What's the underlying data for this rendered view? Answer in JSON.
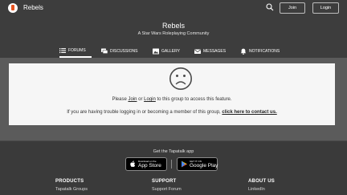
{
  "topbar": {
    "app_title": "Rebels",
    "join_label": "Join",
    "login_label": "Login"
  },
  "header": {
    "group_name": "Rebels",
    "group_description": "A Star Wars Roleplaying Community",
    "tabs": [
      {
        "label": "FORUMS",
        "icon": "list-icon",
        "active": true
      },
      {
        "label": "DISCUSSIONS",
        "icon": "chat-icon",
        "active": false
      },
      {
        "label": "GALLERY",
        "icon": "image-icon",
        "active": false
      },
      {
        "label": "MESSAGES",
        "icon": "envelope-icon",
        "active": false
      },
      {
        "label": "NOTIFICATIONS",
        "icon": "bell-icon",
        "active": false
      }
    ]
  },
  "notice": {
    "icon": "sad-face-icon",
    "line1_prefix": "Please ",
    "join_link": "Join",
    "line1_or": " or ",
    "login_link": "Login",
    "line1_suffix": " to this group to access this feature.",
    "line2_prefix": "If you are having trouble logging in or becoming a member of this group, ",
    "contact_link": "click here to contact us."
  },
  "footer": {
    "get_app": "Get the Tapatalk app",
    "app_store": {
      "small": "Download on the",
      "big": "App Store"
    },
    "google_play": {
      "small": "GET IT ON",
      "big": "Google Play"
    },
    "columns": [
      {
        "heading": "PRODUCTS",
        "items": [
          "Tapatalk Groups"
        ]
      },
      {
        "heading": "SUPPORT",
        "items": [
          "Support Forum"
        ]
      },
      {
        "heading": "ABOUT US",
        "items": [
          "LinkedIn"
        ]
      }
    ]
  },
  "colors": {
    "top_bar": "#3d3d3d",
    "page_background": "#5b5b5b",
    "panel": "#f6f6f6",
    "footer": "#3a3a3a",
    "logo_accent": "#e8531f"
  }
}
